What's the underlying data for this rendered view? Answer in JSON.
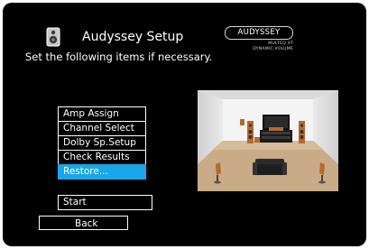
{
  "header": {
    "title": "Audyssey Setup",
    "icon": "speaker-icon",
    "subtitle": "Set the following items if necessary."
  },
  "logo": {
    "badge": "AUDYSSEY",
    "line1": "MULTEQ XT",
    "line2": "DYNAMIC VOLUME"
  },
  "menu": {
    "items": [
      {
        "label": "Amp Assign",
        "selected": false
      },
      {
        "label": "Channel Select",
        "selected": false
      },
      {
        "label": "Dolby Sp.Setup",
        "selected": false
      },
      {
        "label": "Check Results",
        "selected": false
      },
      {
        "label": "Restore...",
        "selected": true
      }
    ],
    "selected_color": "#1aa6e8"
  },
  "buttons": {
    "start": "Start",
    "back": "Back"
  },
  "illustration": {
    "icon": "speaker-room-illustration"
  }
}
